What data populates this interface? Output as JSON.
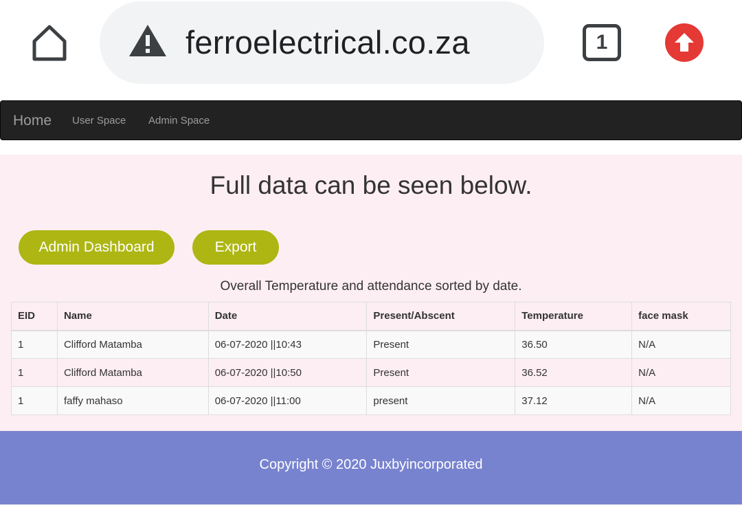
{
  "browser": {
    "url": "ferroelectrical.co.za",
    "tab_count": "1",
    "icons": [
      "home-icon",
      "warning-icon",
      "tab-switcher-icon",
      "upload-arrow-icon"
    ],
    "colors": {
      "upload_button": "#e53935",
      "url_bar": "#f1f3f4"
    }
  },
  "navbar": {
    "brand": "Home",
    "links": [
      "User Space",
      "Admin Space"
    ],
    "colors": {
      "background": "#222222",
      "text": "#9d9d9d"
    }
  },
  "main": {
    "title": "Full data can be seen below.",
    "buttons": {
      "dashboard": "Admin Dashboard",
      "export": "Export"
    },
    "caption": "Overall Temperature and attendance sorted by date.",
    "colors": {
      "background": "#fdeef3",
      "button": "#adb612"
    }
  },
  "table": {
    "headers": [
      "EID",
      "Name",
      "Date",
      "Present/Abscent",
      "Temperature",
      "face mask"
    ],
    "rows": [
      [
        "1",
        "Clifford Matamba",
        "06-07-2020 ||10:43",
        "Present",
        "36.50",
        "N/A"
      ],
      [
        "1",
        "Clifford Matamba",
        "06-07-2020 ||10:50",
        "Present",
        "36.52",
        "N/A"
      ],
      [
        "1",
        "faffy mahaso",
        "06-07-2020 ||11:00",
        "present",
        "37.12",
        "N/A"
      ]
    ]
  },
  "footer": {
    "text": "Copyright © 2020 Juxbyincorporated",
    "colors": {
      "background": "#7883cf"
    }
  }
}
